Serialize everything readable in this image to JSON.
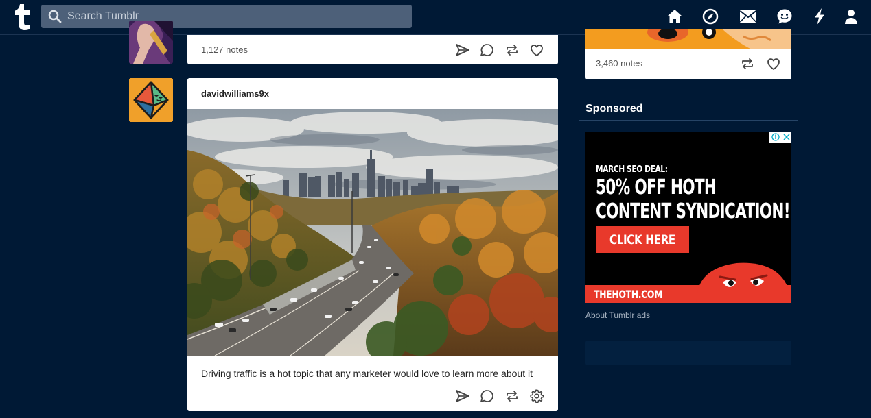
{
  "header": {
    "search_placeholder": "Search Tumblr",
    "nav_icons": [
      "home-icon",
      "explore-icon",
      "inbox-icon",
      "messages-icon",
      "activity-icon",
      "account-icon"
    ]
  },
  "posts": [
    {
      "notes": "1,127 notes",
      "actions": [
        "share-icon",
        "reply-icon",
        "reblog-icon",
        "like-icon"
      ]
    },
    {
      "author": "davidwilliams9x",
      "caption": "Driving traffic is a hot topic that any marketer would love to learn more about it",
      "actions": [
        "share-icon",
        "reply-icon",
        "reblog-icon",
        "settings-icon"
      ]
    }
  ],
  "sidebar": {
    "card_notes": "3,460 notes",
    "sponsored_title": "Sponsored",
    "ad": {
      "line1": "MARCH SEO DEAL:",
      "line2": "50% OFF HOTH",
      "line3": "CONTENT SYNDICATION!",
      "cta": "CLICK HERE",
      "site": "THEHOTH.COM"
    },
    "about_ads": "About Tumblr ads"
  },
  "colors": {
    "background": "#001935",
    "search_bg": "#4d6079",
    "ad_red": "#e8392b",
    "avatar_orange": "#f0a02a"
  }
}
